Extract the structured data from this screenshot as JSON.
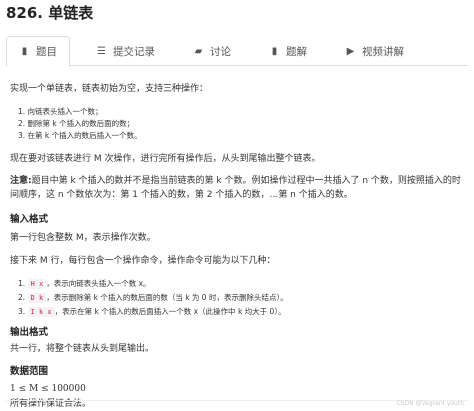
{
  "title": "826. 单链表",
  "tabs": [
    {
      "label": "题目",
      "icon": "book-icon"
    },
    {
      "label": "提交记录",
      "icon": "list-icon"
    },
    {
      "label": "讨论",
      "icon": "comment-icon"
    },
    {
      "label": "题解",
      "icon": "bookmark-icon"
    },
    {
      "label": "视频讲解",
      "icon": "video-icon"
    }
  ],
  "desc": {
    "intro": "实现一个单链表，链表初始为空，支持三种操作：",
    "ops": [
      "1. 向链表头插入一个数；",
      "2. 删除第 k 个插入的数后面的数；",
      "3. 在第 k 个插入的数后插入一个数。"
    ],
    "task": "现在要对该链表进行 M 次操作，进行完所有操作后，从头到尾输出整个链表。",
    "note_label": "注意:",
    "note_line1": "题目中第 k 个插入的数并不是指当前链表的第 k 个数。例如操作过程中一共插入了 n 个数，则按照插入的时",
    "note_line2": "间顺序，这 n 个数依次为：第 1 个插入的数，第 2 个插入的数，…第 n 个插入的数。"
  },
  "input": {
    "heading": "输入格式",
    "line1": "第一行包含整数 M，表示操作次数。",
    "line2": "接下来 M 行，每行包含一个操作命令，操作命令可能为以下几种：",
    "cmds": [
      {
        "num": "1.",
        "code": "H x",
        "text": "，表示向链表头插入一个数 x。"
      },
      {
        "num": "2.",
        "code": "D k",
        "text": "，表示删除第 k 个插入的数后面的数（当 k 为 0 时，表示删除头结点）。"
      },
      {
        "num": "3.",
        "code": "I k x",
        "text": "，表示在第 k 个插入的数后面插入一个数 x（此操作中 k 均大于 0）。"
      }
    ]
  },
  "output": {
    "heading": "输出格式",
    "line": "共一行，将整个链表从头到尾输出。"
  },
  "range": {
    "heading": "数据范围",
    "formula": "1 ≤ M ≤ 100000",
    "line": "所有操作保证合法。"
  },
  "watermark": "CSDN @Vagrant youth"
}
